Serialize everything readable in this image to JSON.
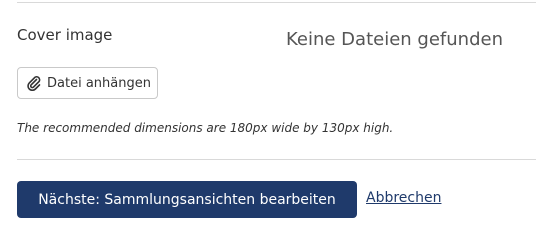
{
  "cover": {
    "label": "Cover image",
    "empty_message": "Keine Dateien gefunden"
  },
  "attach": {
    "label": "Datei anhängen",
    "icon": "paperclip-icon"
  },
  "hint": {
    "text": "The recommended dimensions are 180px wide by 130px high."
  },
  "actions": {
    "next_label": "Nächste: Sammlungsansichten bearbeiten",
    "cancel_label": "Abbrechen"
  },
  "colors": {
    "primary": "#1f3a6b",
    "divider": "#d9d9d9",
    "text": "#333333"
  }
}
